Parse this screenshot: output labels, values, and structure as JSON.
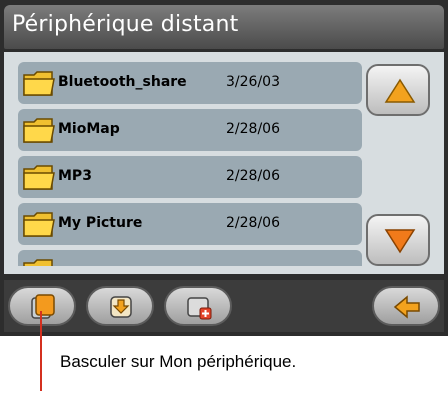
{
  "window": {
    "title": "Périphérique distant"
  },
  "files": [
    {
      "name": "Bluetooth_share",
      "date": "3/26/03",
      "icon": "folder-icon"
    },
    {
      "name": "MioMap",
      "date": "2/28/06",
      "icon": "folder-icon"
    },
    {
      "name": "MP3",
      "date": "2/28/06",
      "icon": "folder-icon"
    },
    {
      "name": "My Picture",
      "date": "2/28/06",
      "icon": "folder-icon"
    }
  ],
  "scroll": {
    "up_icon": "arrow-up-icon",
    "down_icon": "arrow-down-icon"
  },
  "toolbar": {
    "buttons": [
      {
        "icon": "switch-device-icon"
      },
      {
        "icon": "download-icon"
      },
      {
        "icon": "new-folder-icon"
      },
      {
        "icon": "back-arrow-icon"
      }
    ]
  },
  "caption": {
    "text": "Basculer sur Mon périphérique."
  },
  "colors": {
    "accent": "#f3a21e",
    "callout": "#d4301f",
    "list_row": "#9aa9b2",
    "title_bar": "#5f5f5f"
  }
}
